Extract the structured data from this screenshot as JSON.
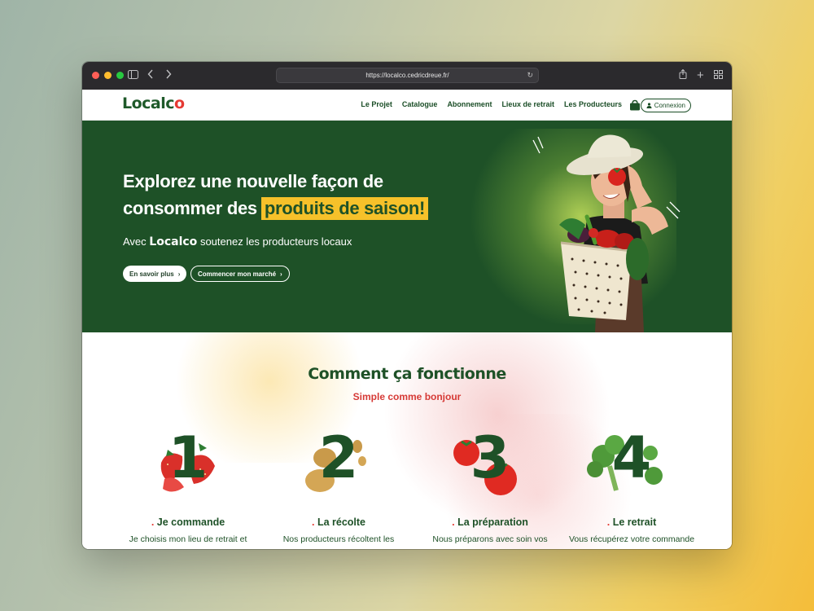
{
  "browser": {
    "url": "https://localco.cedricdreue.fr/"
  },
  "nav": {
    "logo": {
      "prefix": "Localc",
      "suffix": "o"
    },
    "links": [
      "Le Projet",
      "Catalogue",
      "Abonnement",
      "Lieux de retrait",
      "Les Producteurs"
    ],
    "login_label": "Connexion"
  },
  "hero": {
    "line1": "Explorez une nouvelle façon de",
    "line2_prefix": "consommer des",
    "line2_highlight": "produits de saison!",
    "sub_prefix": "Avec",
    "sub_brand": "Localco",
    "sub_suffix": "soutenez les producteurs locaux",
    "btn_primary": "En savoir plus",
    "btn_secondary": "Commencer mon marché"
  },
  "how": {
    "title": "Comment ça fonctionne",
    "subtitle": "Simple comme bonjour",
    "steps": [
      {
        "num": "1",
        "title": "Je commande",
        "desc": "Je choisis mon lieu de retrait et",
        "art": "strawberries"
      },
      {
        "num": "2",
        "title": "La récolte",
        "desc": "Nos producteurs récoltent les",
        "art": "potatoes"
      },
      {
        "num": "3",
        "title": "La préparation",
        "desc": "Nous préparons avec soin vos",
        "art": "tomatoes"
      },
      {
        "num": "4",
        "title": "Le retrait",
        "desc": "Vous récupérez votre commande",
        "art": "broccoli"
      }
    ]
  },
  "colors": {
    "brand_green": "#1e5127",
    "accent_red": "#e53a33",
    "highlight_yellow": "#f6c12a"
  }
}
